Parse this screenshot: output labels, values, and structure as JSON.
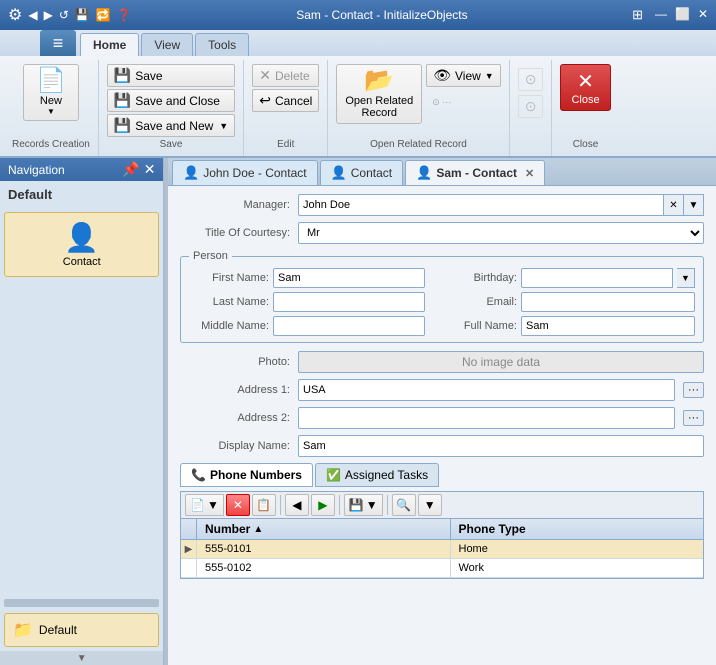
{
  "window": {
    "title": "Sam - Contact - InitializeObjects"
  },
  "quickaccess": {
    "btns": [
      "💾",
      "↩",
      "→",
      "⚙"
    ]
  },
  "ribbontabs": [
    "Home",
    "View",
    "Tools"
  ],
  "ribbon": {
    "groups": {
      "records_creation": {
        "label": "Records Creation",
        "new_label": "New",
        "new_icon": "📄"
      },
      "save": {
        "label": "Save",
        "btns": [
          "Save",
          "Save and Close",
          "Save and New"
        ]
      },
      "edit": {
        "label": "Edit",
        "btns": [
          "Delete",
          "Cancel"
        ]
      },
      "open_related": {
        "label": "Open Related Record",
        "btns": [
          "Open Related Record",
          "View"
        ]
      },
      "close": {
        "label": "Close",
        "btn": "Close"
      }
    }
  },
  "nav": {
    "header": "Navigation",
    "default_label": "Default",
    "contact_label": "Contact",
    "footer_label": "Default"
  },
  "doctabs": [
    {
      "label": "John Doe - Contact",
      "active": false,
      "closeable": false
    },
    {
      "label": "Contact",
      "active": false,
      "closeable": false
    },
    {
      "label": "Sam - Contact",
      "active": true,
      "closeable": true
    }
  ],
  "form": {
    "manager_label": "Manager:",
    "manager_value": "John Doe",
    "title_courtesy_label": "Title Of Courtesy:",
    "title_courtesy_value": "Mr",
    "person_group": "Person",
    "first_name_label": "First Name:",
    "first_name_value": "Sam",
    "birthday_label": "Birthday:",
    "birthday_value": "",
    "last_name_label": "Last Name:",
    "last_name_value": "",
    "email_label": "Email:",
    "email_value": "",
    "middle_name_label": "Middle Name:",
    "middle_name_value": "",
    "full_name_label": "Full Name:",
    "full_name_value": "Sam",
    "photo_label": "Photo:",
    "photo_placeholder": "No image data",
    "address1_label": "Address 1:",
    "address1_value": "USA",
    "address2_label": "Address 2:",
    "address2_value": "",
    "display_name_label": "Display Name:",
    "display_name_value": "Sam"
  },
  "tabs": [
    {
      "label": "Phone Numbers",
      "icon": "📞",
      "active": true
    },
    {
      "label": "Assigned Tasks",
      "icon": "✅",
      "active": false
    }
  ],
  "grid": {
    "columns": [
      {
        "label": "Number",
        "sort": "▲",
        "width": "50%"
      },
      {
        "label": "Phone Type",
        "width": "50%"
      }
    ],
    "rows": [
      {
        "number": "555-0101",
        "phone_type": "Home",
        "selected": true
      },
      {
        "number": "555-0102",
        "phone_type": "Work",
        "selected": false
      }
    ]
  }
}
